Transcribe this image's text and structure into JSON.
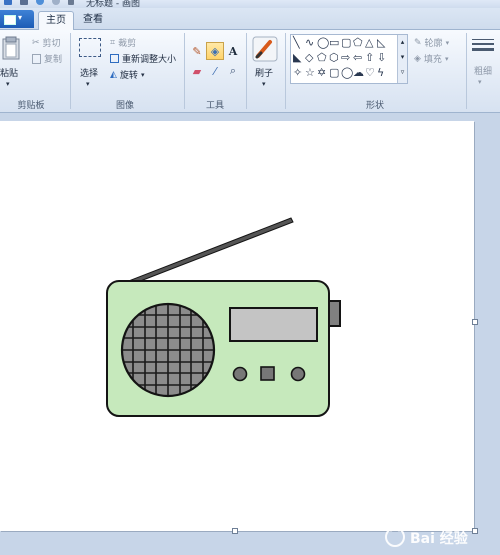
{
  "title_bar": {
    "title": "无标题 - 画图"
  },
  "tabs": {
    "home": "主页",
    "view": "查看"
  },
  "clipboard": {
    "paste": "粘贴",
    "cut": "剪切",
    "copy": "复制",
    "group": "剪贴板"
  },
  "image": {
    "select": "选择",
    "crop": "裁剪",
    "resize": "重新调整大小",
    "rotate": "旋转",
    "group": "图像"
  },
  "tools": {
    "group": "工具",
    "text_tool": "A"
  },
  "brush": {
    "label": "刷子"
  },
  "shapes": {
    "outline": "轮廓",
    "fill": "填充",
    "group": "形状"
  },
  "size": {
    "label": "粗细"
  },
  "watermark": {
    "text": "Bai 经验"
  },
  "colors": {
    "radio_body": "#c6e9bc",
    "speaker": "#8c8c8c",
    "display": "#c4c4c4",
    "control": "#777777",
    "outline": "#141414"
  }
}
